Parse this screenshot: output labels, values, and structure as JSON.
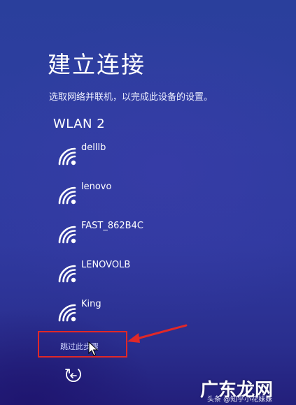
{
  "page": {
    "title": "建立连接",
    "subtitle": "选取网络并联机，以完成此设备的设置。",
    "section_label": "WLAN 2"
  },
  "networks": [
    {
      "name": "delllb",
      "icon": "wifi-icon"
    },
    {
      "name": "lenovo",
      "icon": "wifi-icon"
    },
    {
      "name": "FAST_862B4C",
      "icon": "wifi-icon"
    },
    {
      "name": "LENOVOLB",
      "icon": "wifi-icon"
    },
    {
      "name": "King",
      "icon": "wifi-icon"
    }
  ],
  "actions": {
    "skip_label": "跳过此步骤",
    "back_icon": "back-arrow-icon"
  },
  "annotation": {
    "highlight_color": "#e02828",
    "pointer_icon": "red-arrow-icon"
  },
  "watermark": {
    "logo": "广东龙网",
    "caption": "头条 @知乎小花妹妹"
  }
}
